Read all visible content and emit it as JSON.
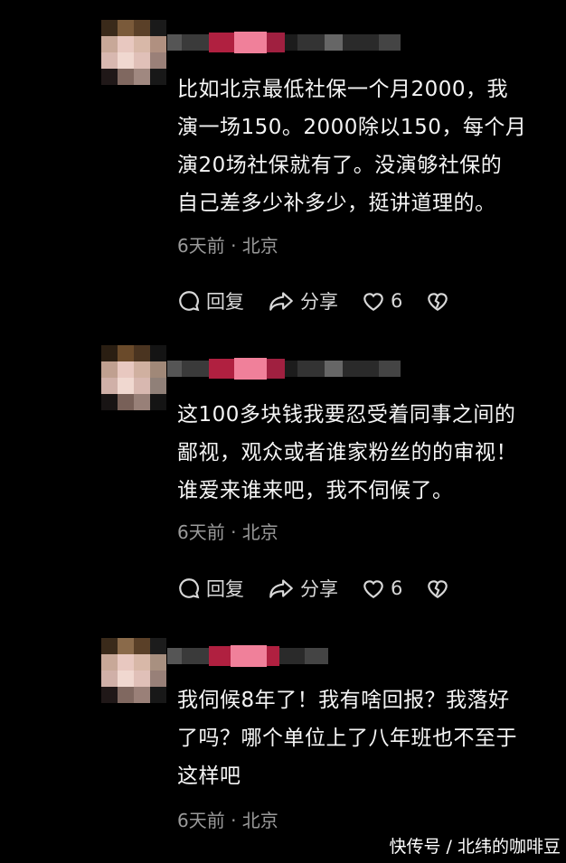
{
  "comments": [
    {
      "text": "比如北京最低社保一个月2000，我\n演一场150。2000除以150，每个月\n演20场社保就有了。没演够社保的\n自己差多少补多少，挺讲道理的。",
      "meta": "6天前 · 北京",
      "reply_label": "回复",
      "share_label": "分享",
      "like_count": "6"
    },
    {
      "text": "这100多块钱我要忍受着同事之间的\n鄙视，观众或者谁家粉丝的的审视！\n谁爱来谁来吧，我不伺候了。",
      "meta": "6天前 · 北京",
      "reply_label": "回复",
      "share_label": "分享",
      "like_count": "6"
    },
    {
      "text": "我伺候8年了！我有啥回报？我落好\n了吗？哪个单位上了八年班也不至于\n这样吧",
      "meta": "6天前 · 北京"
    }
  ],
  "watermark": "快传号 / 北纬的咖啡豆",
  "colors": {
    "background": "#000000",
    "text": "#f5f5f5",
    "meta": "#9a9a9a",
    "username_pink": "#e0456e"
  }
}
